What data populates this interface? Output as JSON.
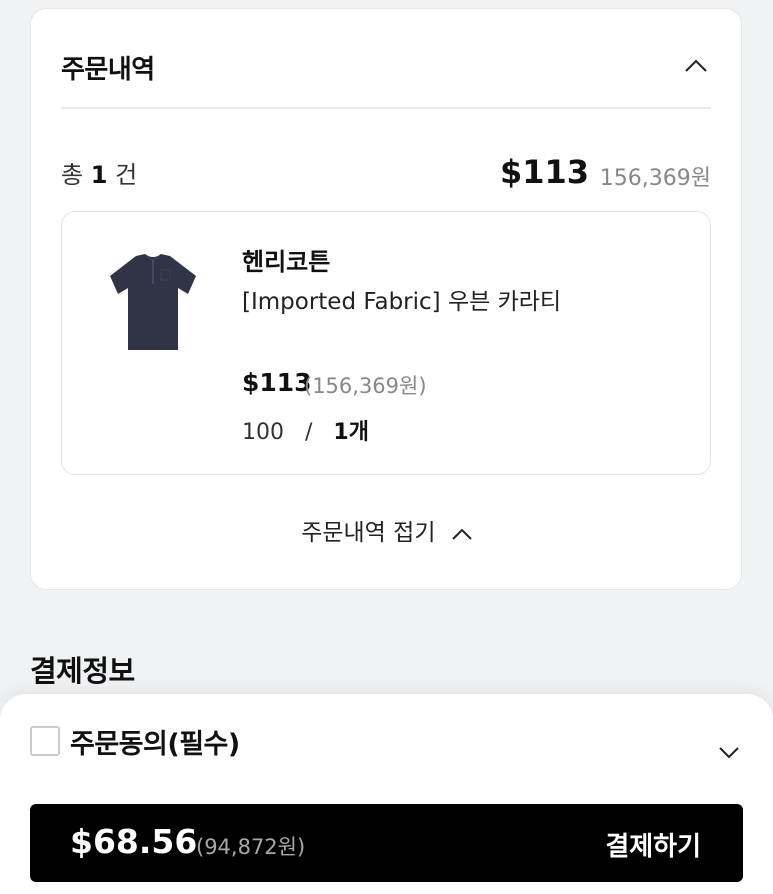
{
  "order_summary": {
    "title": "주문내역",
    "count_prefix": "총",
    "count": "1",
    "count_suffix": "건",
    "total_usd": "$113",
    "total_krw": "156,369원",
    "fold_label": "주문내역 접기"
  },
  "product": {
    "brand": "헨리코튼",
    "name": "[Imported Fabric] 우븐 카라티",
    "price_usd": "$113",
    "price_krw": "(156,369원)",
    "size": "100",
    "separator": "/",
    "quantity": "1개",
    "image_icon": "polo-shirt-image"
  },
  "payment_info": {
    "title": "결제정보"
  },
  "bottom_sheet": {
    "agreement_label": "주문동의(필수)",
    "agreement_checked": false,
    "pay_usd": "$68.56",
    "pay_krw": "(94,872원)",
    "pay_label": "결제하기"
  }
}
